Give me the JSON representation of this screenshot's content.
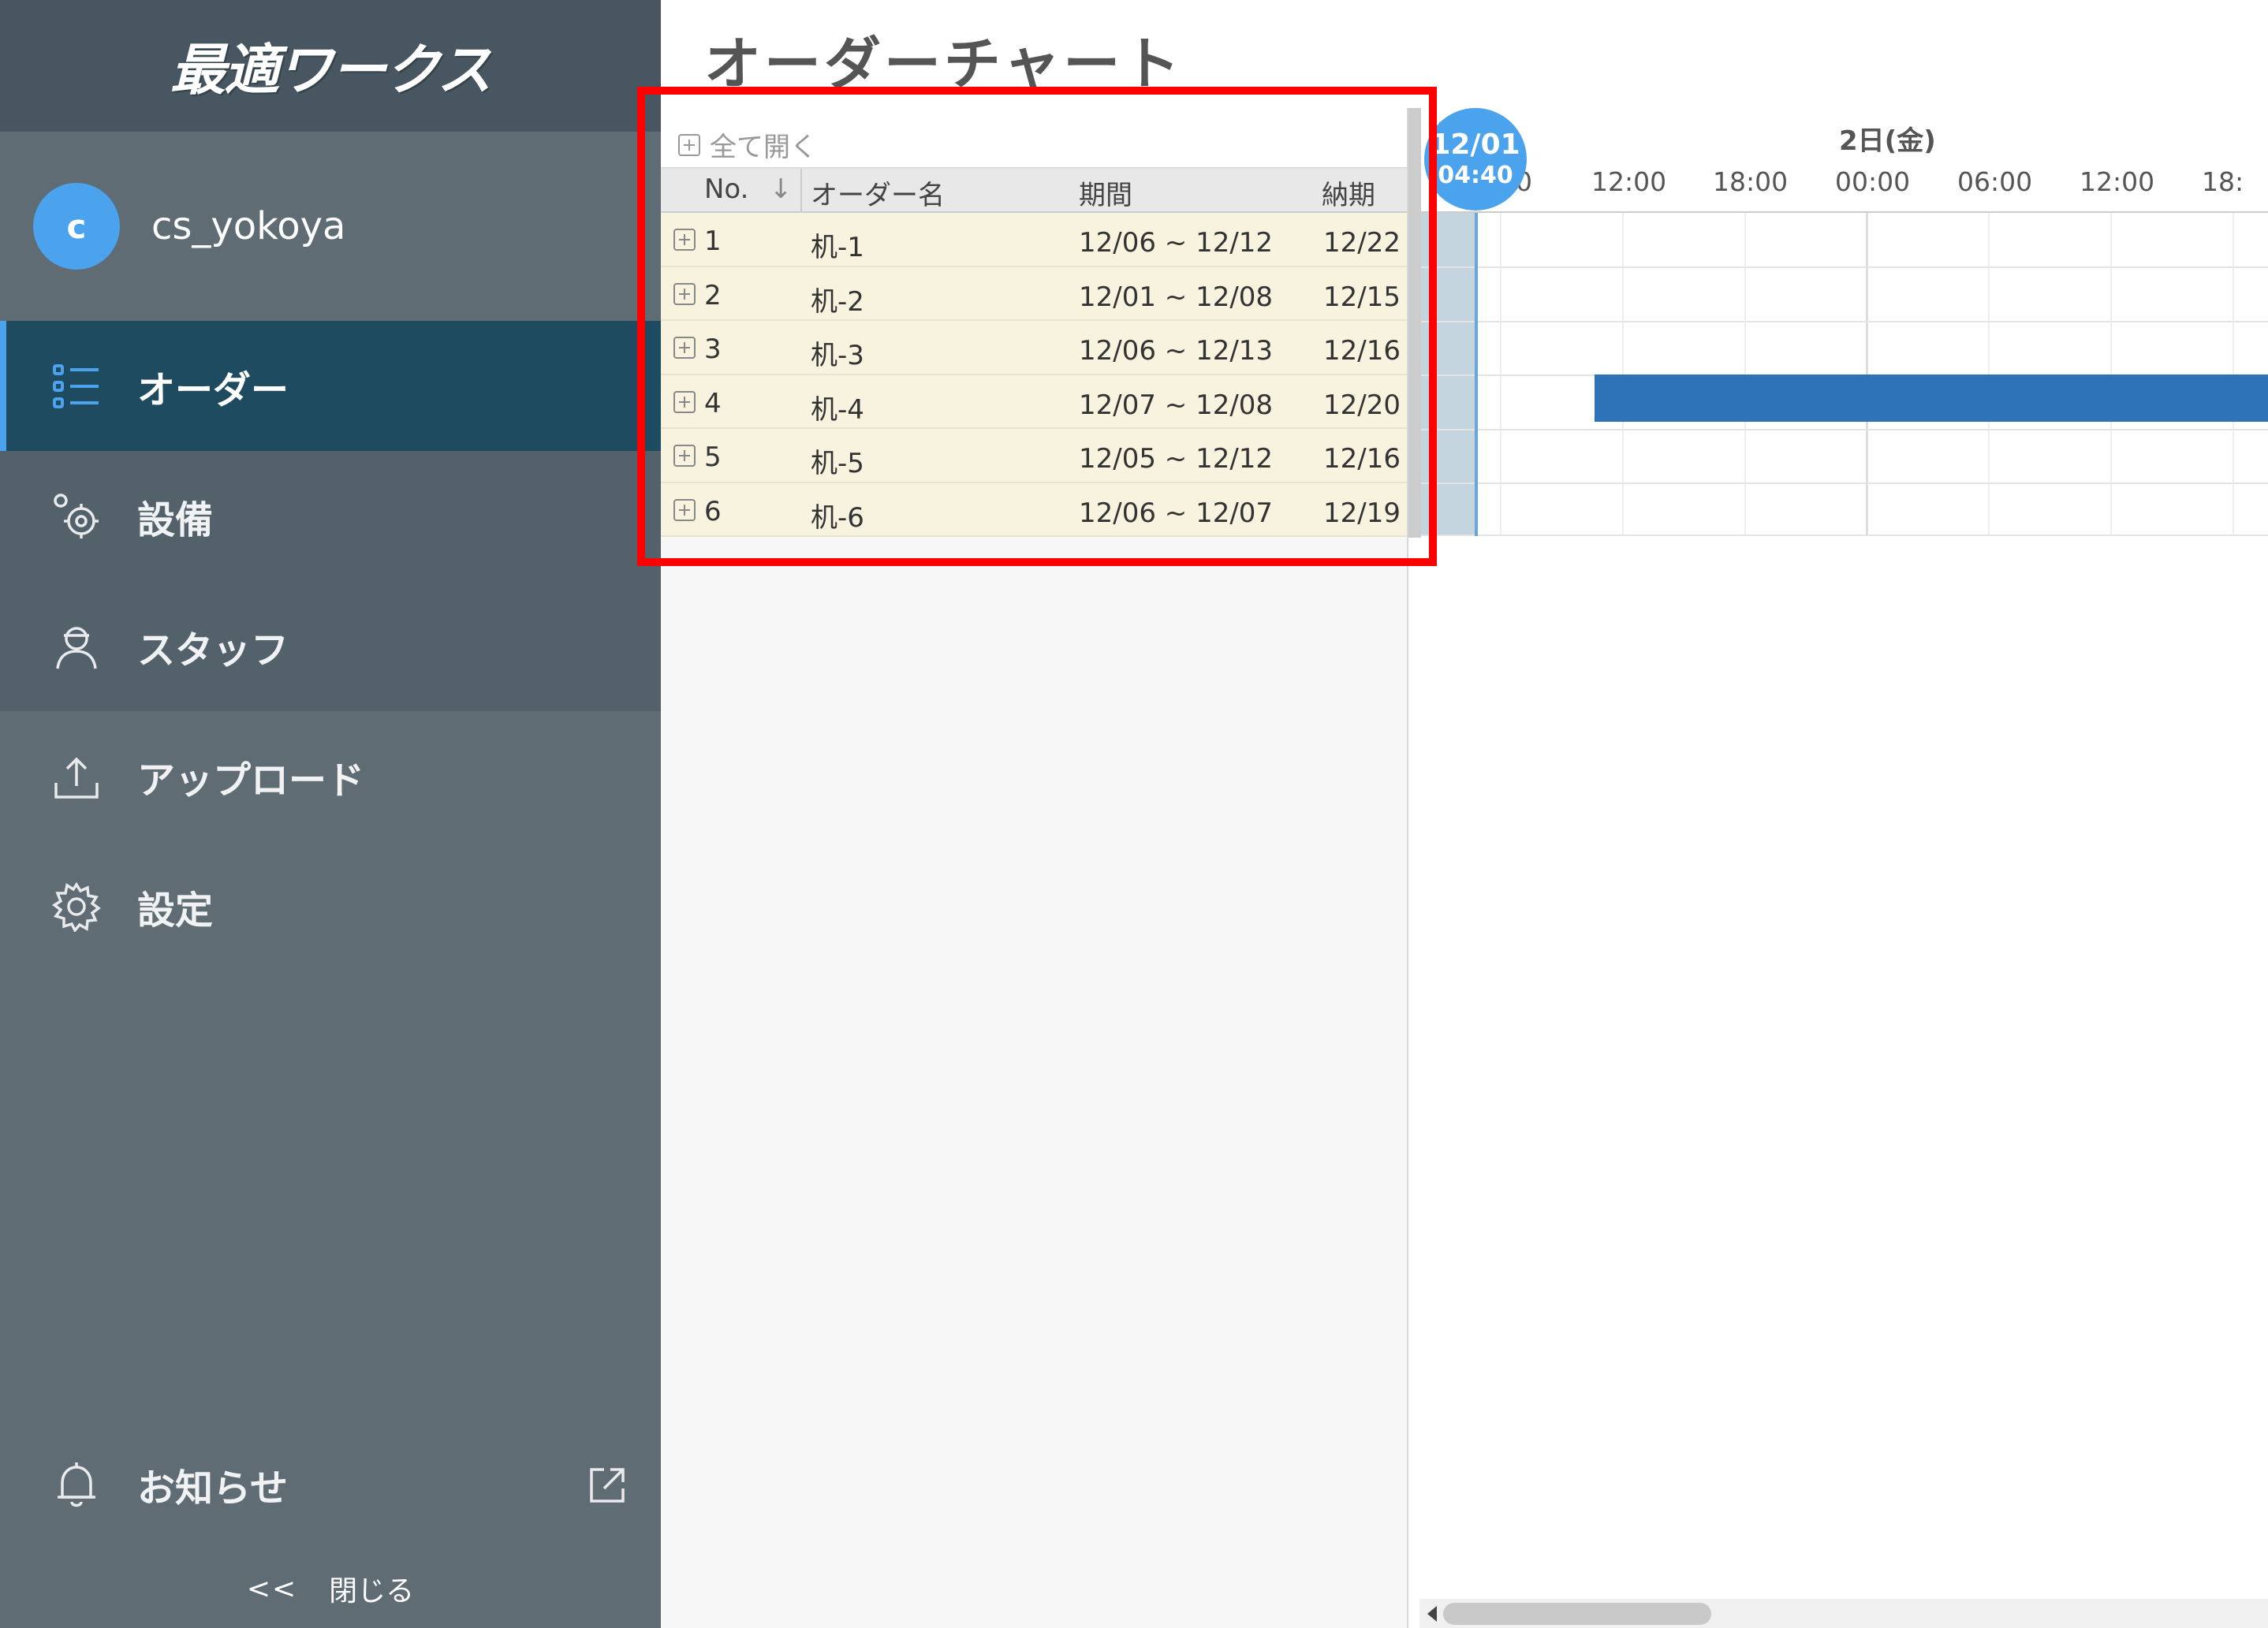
{
  "app": {
    "logo": "最適ワークス"
  },
  "user": {
    "initial": "c",
    "name": "cs_yokoya"
  },
  "nav": {
    "orders": "オーダー",
    "equipment": "設備",
    "staff": "スタッフ",
    "upload": "アップロード",
    "settings": "設定",
    "notifications": "お知らせ",
    "close_chevron": "<<",
    "close": "閉じる"
  },
  "page": {
    "title": "オーダーチャート"
  },
  "grid": {
    "expand_all": "全て開く",
    "columns": {
      "no": "No.",
      "sort_icon": "↓",
      "name": "オーダー名",
      "period": "期間",
      "due": "納期"
    },
    "rows": [
      {
        "no": "1",
        "name": "机-1",
        "period": "12/06 ~ 12/12",
        "due": "12/22"
      },
      {
        "no": "2",
        "name": "机-2",
        "period": "12/01 ~ 12/08",
        "due": "12/15"
      },
      {
        "no": "3",
        "name": "机-3",
        "period": "12/06 ~ 12/13",
        "due": "12/16"
      },
      {
        "no": "4",
        "name": "机-4",
        "period": "12/07 ~ 12/08",
        "due": "12/20"
      },
      {
        "no": "5",
        "name": "机-5",
        "period": "12/05 ~ 12/12",
        "due": "12/16"
      },
      {
        "no": "6",
        "name": "机-6",
        "period": "12/06 ~ 12/07",
        "due": "12/19"
      }
    ]
  },
  "gantt": {
    "prev_fragment": "1",
    "cut_zero": "0",
    "day_label": "2日(金)",
    "hours": [
      "12:00",
      "18:00",
      "00:00",
      "06:00",
      "12:00",
      "18:"
    ],
    "now": {
      "date": "12/01",
      "time": "04:40"
    },
    "bar_color": "#2e73b8"
  },
  "colors": {
    "accent": "#4aa3ec",
    "sidebar": "#5f6c73",
    "active_nav": "#1f4b61",
    "row_bg": "#f7f3df",
    "highlight": "#ff0000"
  }
}
